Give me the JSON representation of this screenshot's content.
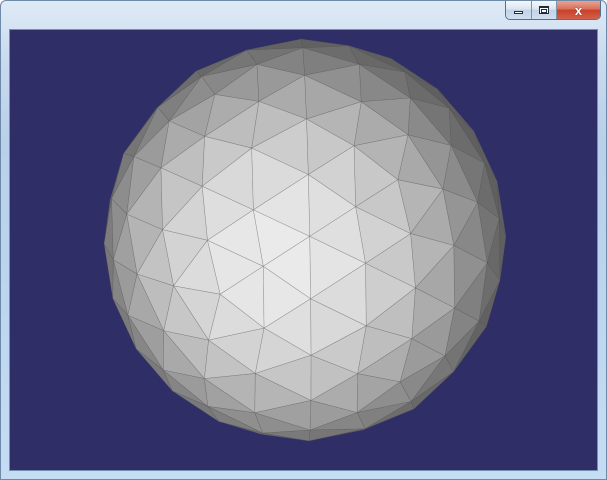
{
  "window": {
    "title": "",
    "buttons": {
      "minimize": {
        "icon": "minimize-icon"
      },
      "maximize": {
        "icon": "restore-icon"
      },
      "close": {
        "icon": "close-icon",
        "glyph": "x"
      }
    }
  },
  "viewport": {
    "background_color": "#302e66",
    "object": "faceted-sphere",
    "object_color": "#e6e6e6",
    "edge_color": "#575757"
  }
}
